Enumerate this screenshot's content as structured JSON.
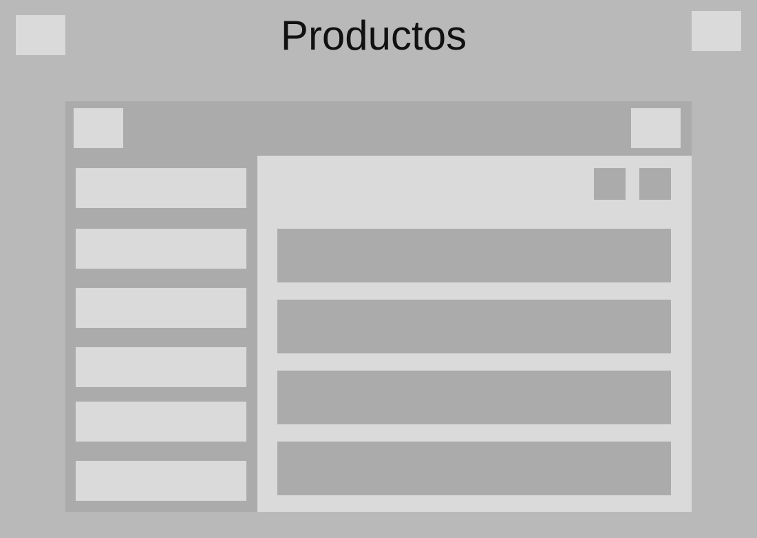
{
  "header": {
    "title": "Productos"
  },
  "colors": {
    "background": "#b9b9b9",
    "light_block": "#dadada",
    "mid_block": "#ababab",
    "title_text": "#111111"
  }
}
